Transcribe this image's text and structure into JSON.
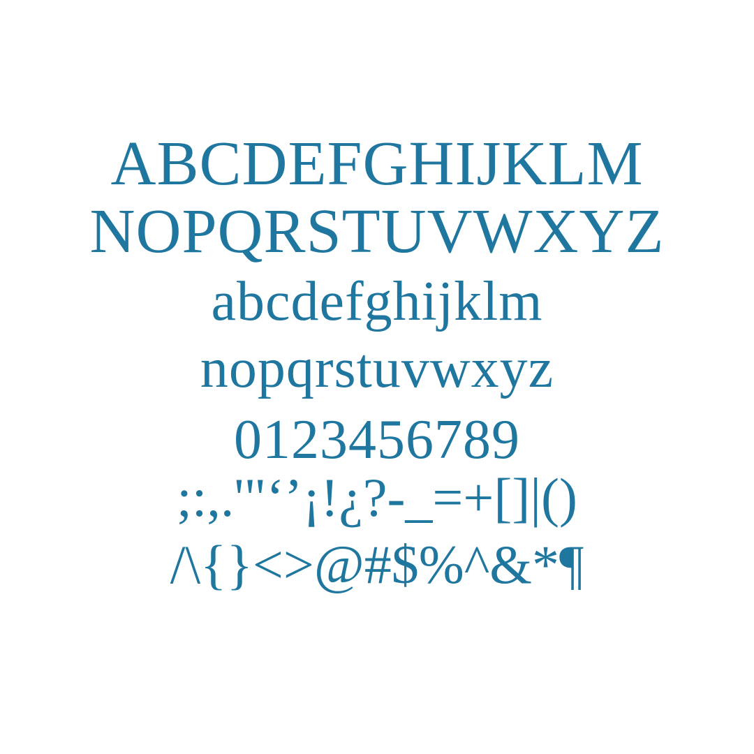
{
  "specimen": {
    "color": "#1f77a0",
    "lines": {
      "uppercase_1": "ABCDEFGHIJKLM",
      "uppercase_2": "NOPQRSTUVWXYZ",
      "lowercase_1": "abcdefghijklm",
      "lowercase_2": "nopqrstuvwxyz",
      "numerals": "0123456789",
      "punctuation_1": ";:,.'\"‘’¡!¿?-_=+[]|()",
      "punctuation_2": "/\\{}<>@#$%^&*¶"
    }
  }
}
